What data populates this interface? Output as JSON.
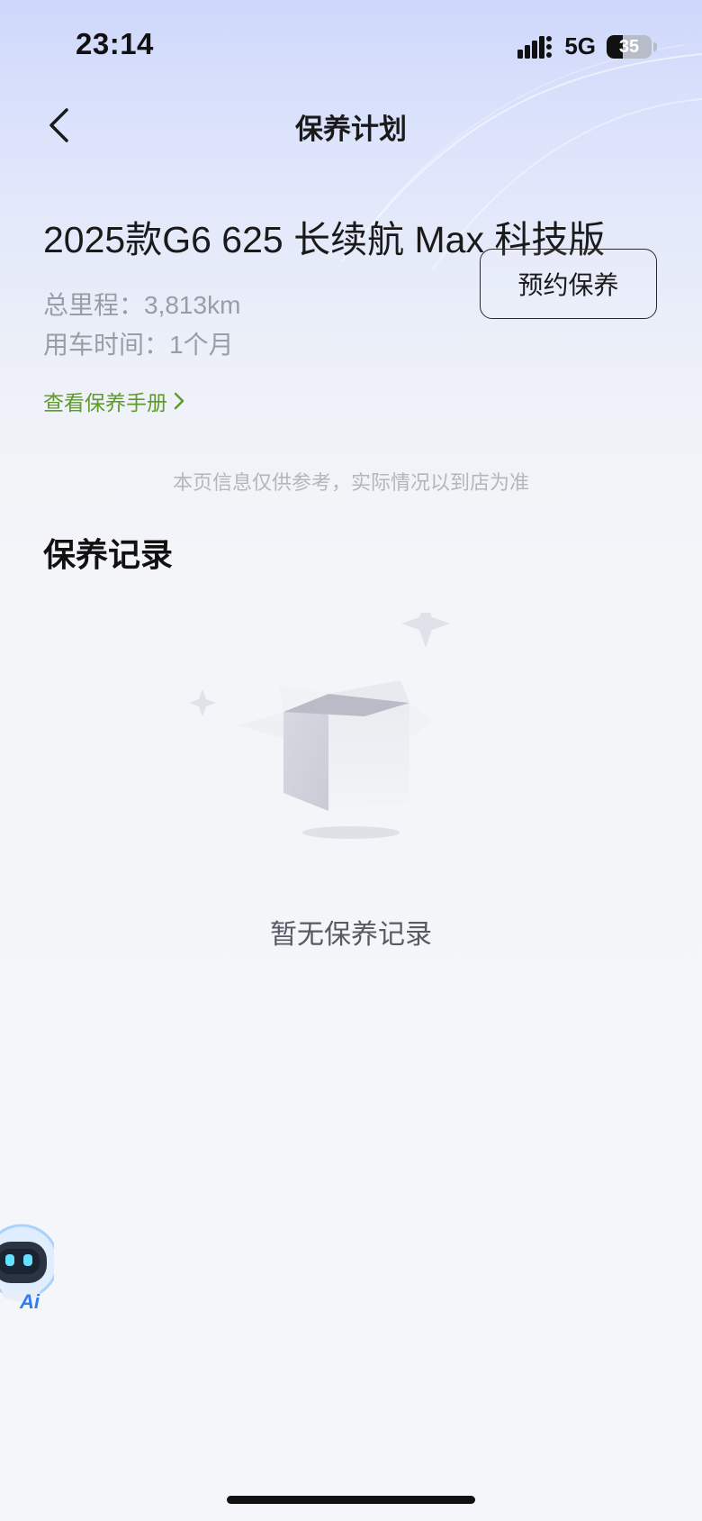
{
  "status_bar": {
    "time": "23:14",
    "network": "5G",
    "battery": "35",
    "battery_level": 0.35,
    "signal_icon": "signal-bars-icon"
  },
  "nav": {
    "title": "保养计划",
    "back_icon": "chevron-left-icon"
  },
  "vehicle": {
    "model": "2025款G6 625 长续航 Max 科技版",
    "mileage": "总里程：3,813km",
    "usage_time": "用车时间：1个月"
  },
  "actions": {
    "book_maintenance": "预约保养",
    "view_manual": "查看保养手册"
  },
  "disclaimer": "本页信息仅供参考，实际情况以到店为准",
  "records": {
    "title": "保养记录",
    "empty_text": "暂无保养记录",
    "empty_icon": "empty-box-icon"
  },
  "ai_assistant": {
    "label": "Ai",
    "icon": "robot-icon"
  },
  "colors": {
    "accent_green": "#5f9a2a",
    "text_primary": "#1a1a1a",
    "text_secondary": "#9a9da6",
    "ai_blue": "#2f7cf6"
  }
}
